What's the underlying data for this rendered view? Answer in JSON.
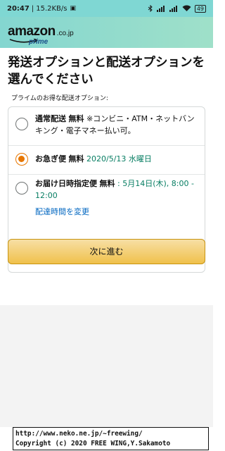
{
  "status_bar": {
    "time": "20:47",
    "network_speed": "15.2KB/s",
    "battery": "49"
  },
  "header": {
    "logo_word": "amazon",
    "logo_tld": ".co.jp",
    "logo_sub": "prime"
  },
  "page": {
    "title": "発送オプションと配送オプションを選んでください",
    "subtitle": "プライムのお得な配送オプション:"
  },
  "options": [
    {
      "name": "通常配送",
      "price": "無料",
      "detail": " ※コンビニ・ATM・ネットバンキング・電子マネー払い可。",
      "selected": false
    },
    {
      "name": "お急ぎ便",
      "price": "無料",
      "detail": " 2020/5/13 水曜日",
      "selected": true
    },
    {
      "name": "お届け日時指定便",
      "price": "無料",
      "detail": " : 5月14日(木), 8:00 - 12:00",
      "link": "配達時間を変更",
      "selected": false
    }
  ],
  "next_button": "次に進む",
  "caption": {
    "line1": "http://www.neko.ne.jp/~freewing/",
    "line2": "Copyright (c) 2020 FREE WING,Y.Sakamoto"
  }
}
